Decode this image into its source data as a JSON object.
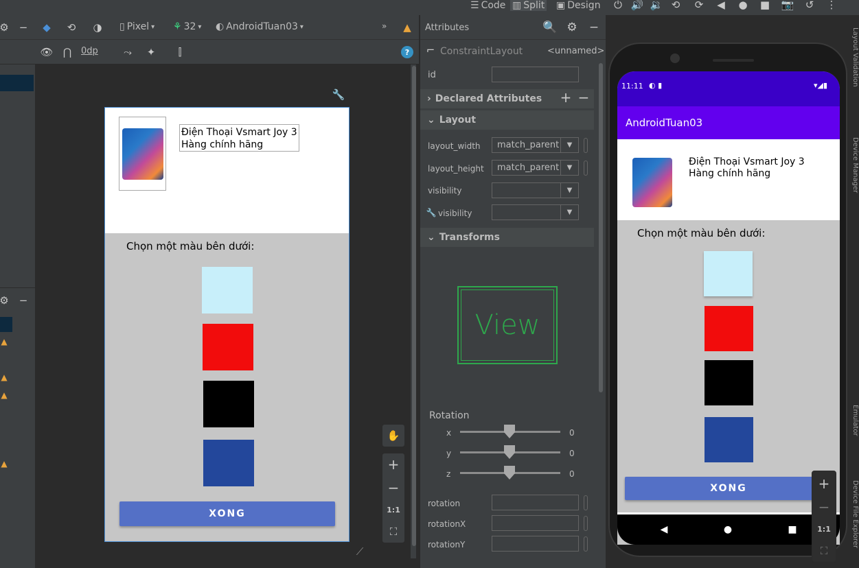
{
  "toolbar_top": {
    "code_label": "Code",
    "split_label": "Split",
    "design_label": "Design"
  },
  "design_toolbar": {
    "device": "Pixel",
    "api_level": "32",
    "theme": "AndroidTuan03",
    "margin_value": "0dp",
    "collapse_glyph": "»"
  },
  "layout_preview": {
    "product_line1": "Điện Thoại Vsmart Joy 3",
    "product_line2": "Hàng chính hãng",
    "choose_color_label": "Chọn một màu bên dưới:",
    "button_label": "XONG"
  },
  "swatch_colors": [
    "#c8effa",
    "#f20c0c",
    "#000000",
    "#23479b"
  ],
  "attributes": {
    "panel_title": "Attributes",
    "component": "ConstraintLayout",
    "component_id": "<unnamed>",
    "id_label": "id",
    "declared_section": "Declared Attributes",
    "layout_section": "Layout",
    "layout_width_label": "layout_width",
    "layout_width_value": "match_parent",
    "layout_height_label": "layout_height",
    "layout_height_value": "match_parent",
    "visibility_label": "visibility",
    "tools_visibility_label": "visibility",
    "transforms_section": "Transforms",
    "view_preview": "View",
    "rotation_title": "Rotation",
    "rot_x_label": "x",
    "rot_x_value": "0",
    "rot_y_label": "y",
    "rot_y_value": "0",
    "rot_z_label": "z",
    "rot_z_value": "0",
    "rotation_label": "rotation",
    "rotationX_label": "rotationX",
    "rotationY_label": "rotationY"
  },
  "emulator": {
    "time": "11:11",
    "app_title": "AndroidTuan03",
    "product_line1": "Điện Thoại Vsmart Joy 3",
    "product_line2": "Hàng chính hãng",
    "choose_color_label": "Chọn một màu bên dưới:",
    "button_label": "XONG"
  },
  "zoom": {
    "plus": "+",
    "minus": "−",
    "one_to_one": "1:1"
  },
  "side_tabs": [
    "Layout Validation",
    "Device Manager",
    "Emulator",
    "Device File Explorer"
  ]
}
